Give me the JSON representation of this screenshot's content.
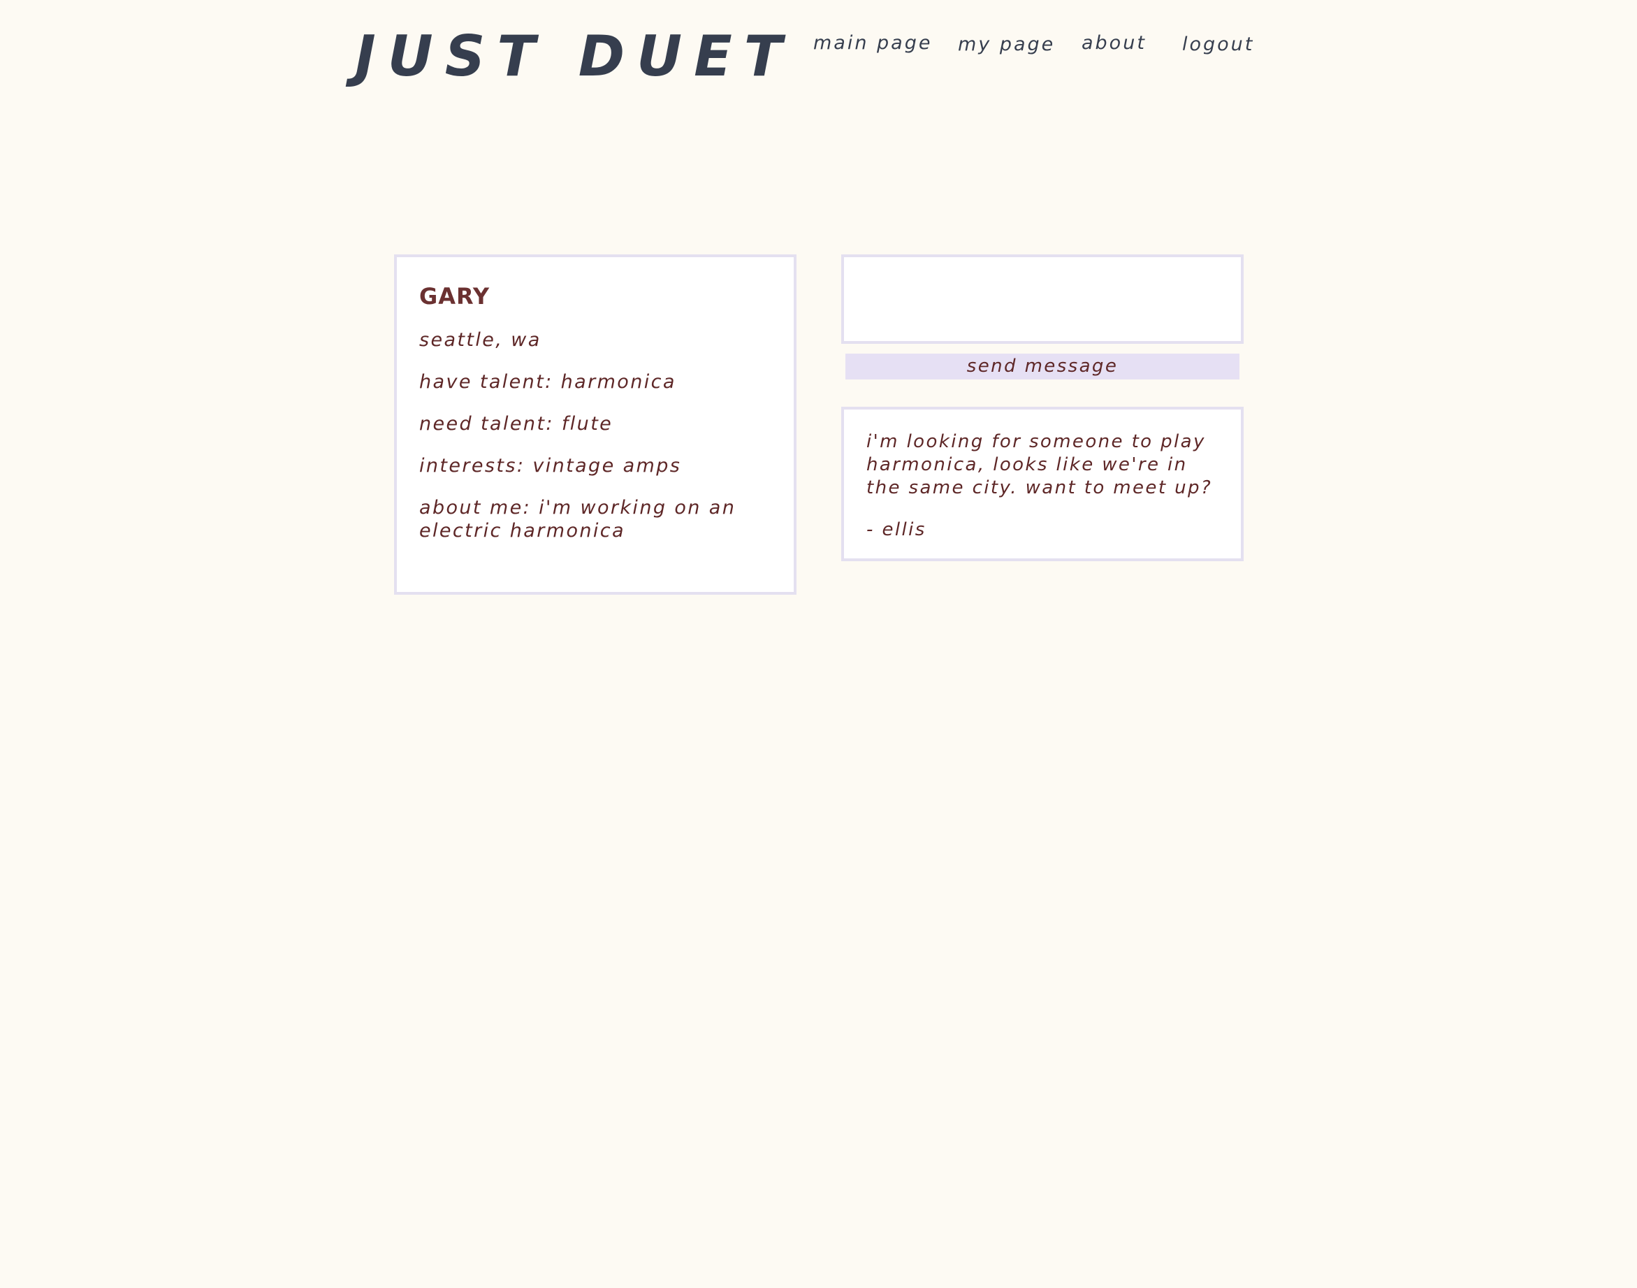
{
  "header": {
    "brand": "JUST DUET",
    "nav": {
      "main_page": "main page",
      "my_page": "my page",
      "about": "about",
      "logout": "logout"
    }
  },
  "profile": {
    "name": "GARY",
    "location": "seattle, wa",
    "have_talent": "have talent: harmonica",
    "need_talent": "need talent: flute",
    "interests": "interests: vintage amps",
    "about_me": "about me: i'm working on an electric harmonica"
  },
  "compose": {
    "value": "",
    "send_label": "send message"
  },
  "messages": [
    {
      "body": "i'm looking for someone to play harmonica, looks like we're in the same city. want to meet up?",
      "signature": "- ellis"
    }
  ],
  "colors": {
    "background": "#fdfaf3",
    "brand_text": "#363e4e",
    "body_text": "#5e2727",
    "card_border": "#e4e0f0",
    "button_bg": "#e6e0f4"
  }
}
